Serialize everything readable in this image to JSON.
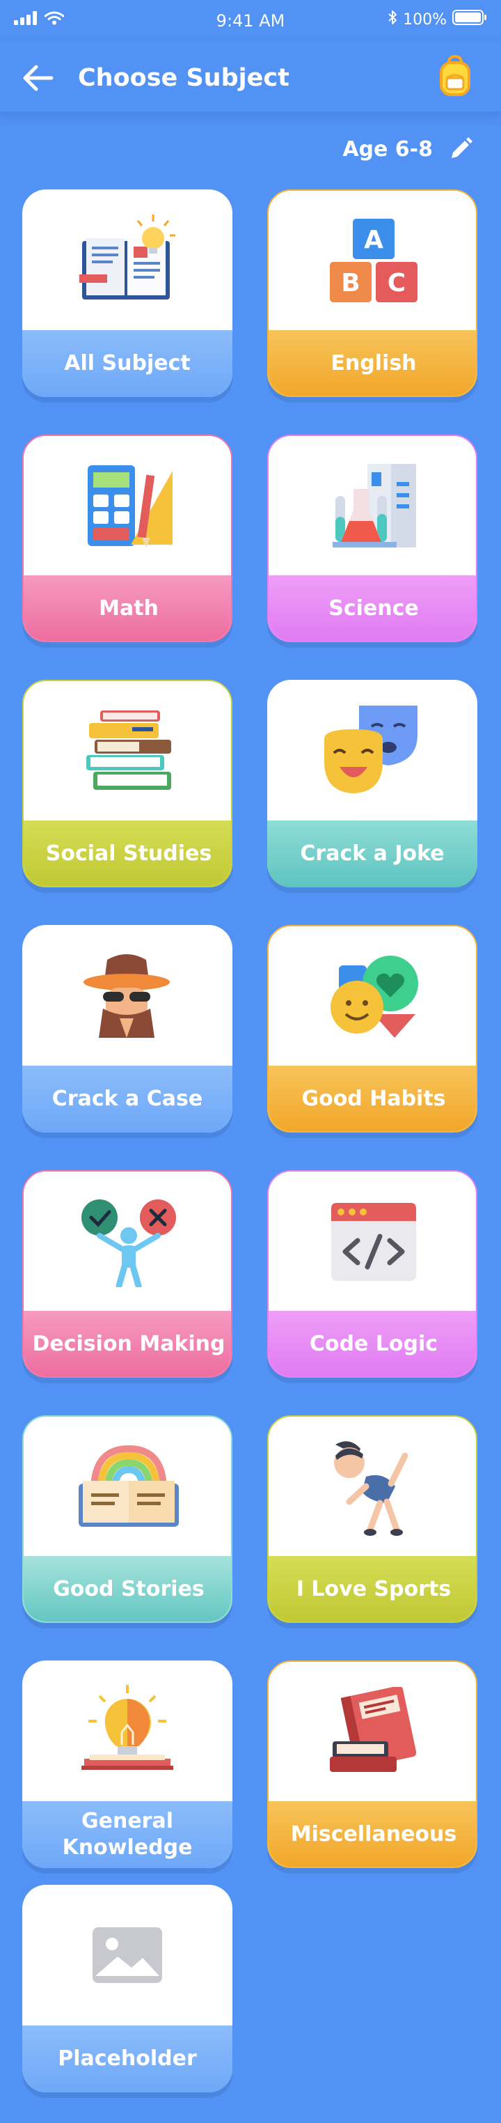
{
  "status_bar": {
    "time": "9:41 AM",
    "battery": "100%"
  },
  "header": {
    "title": "Choose Subject"
  },
  "age": {
    "label": "Age 6-8"
  },
  "subjects": [
    {
      "label": "All Subject",
      "border": "#ffffff",
      "bar": [
        "#8bbcfb",
        "#6ea8f8"
      ]
    },
    {
      "label": "English",
      "border": "#f6b63d",
      "bar": [
        "#f7c45a",
        "#f1a629"
      ]
    },
    {
      "label": "Math",
      "border": "#ef77ac",
      "bar": [
        "#f69ac0",
        "#ec6d9f"
      ]
    },
    {
      "label": "Science",
      "border": "#e281f4",
      "bar": [
        "#ee9ef8",
        "#e07af2"
      ]
    },
    {
      "label": "Social Studies",
      "border": "#c7d13e",
      "bar": [
        "#d5dd55",
        "#c0c833"
      ]
    },
    {
      "label": "Crack a Joke",
      "border": "#ffffff",
      "bar": [
        "#8fdcd6",
        "#5ec4c0"
      ]
    },
    {
      "label": "Crack a Case",
      "border": "#ffffff",
      "bar": [
        "#8bbcfb",
        "#6ea8f8"
      ]
    },
    {
      "label": "Good Habits",
      "border": "#f6b63d",
      "bar": [
        "#f7c45a",
        "#f1a629"
      ]
    },
    {
      "label": "Decision Making",
      "border": "#ef77ac",
      "bar": [
        "#f69ac0",
        "#ec6d9f"
      ]
    },
    {
      "label": "Code Logic",
      "border": "#e281f4",
      "bar": [
        "#ee9ef8",
        "#e07af2"
      ]
    },
    {
      "label": "Good Stories",
      "border": "#8fdcd6",
      "bar": [
        "#a6e3dc",
        "#62c6c1"
      ]
    },
    {
      "label": "I Love Sports",
      "border": "#c7d13e",
      "bar": [
        "#d5dd55",
        "#c0c833"
      ]
    },
    {
      "label": "General Knowledge",
      "border": "#ffffff",
      "bar": [
        "#8bbcfb",
        "#6ea8f8"
      ]
    },
    {
      "label": "Miscellaneous",
      "border": "#f6b63d",
      "bar": [
        "#f7c45a",
        "#f1a629"
      ]
    },
    {
      "label": "Placeholder",
      "border": "#ffffff",
      "bar": [
        "#8bbcfb",
        "#6ea8f8"
      ]
    }
  ]
}
